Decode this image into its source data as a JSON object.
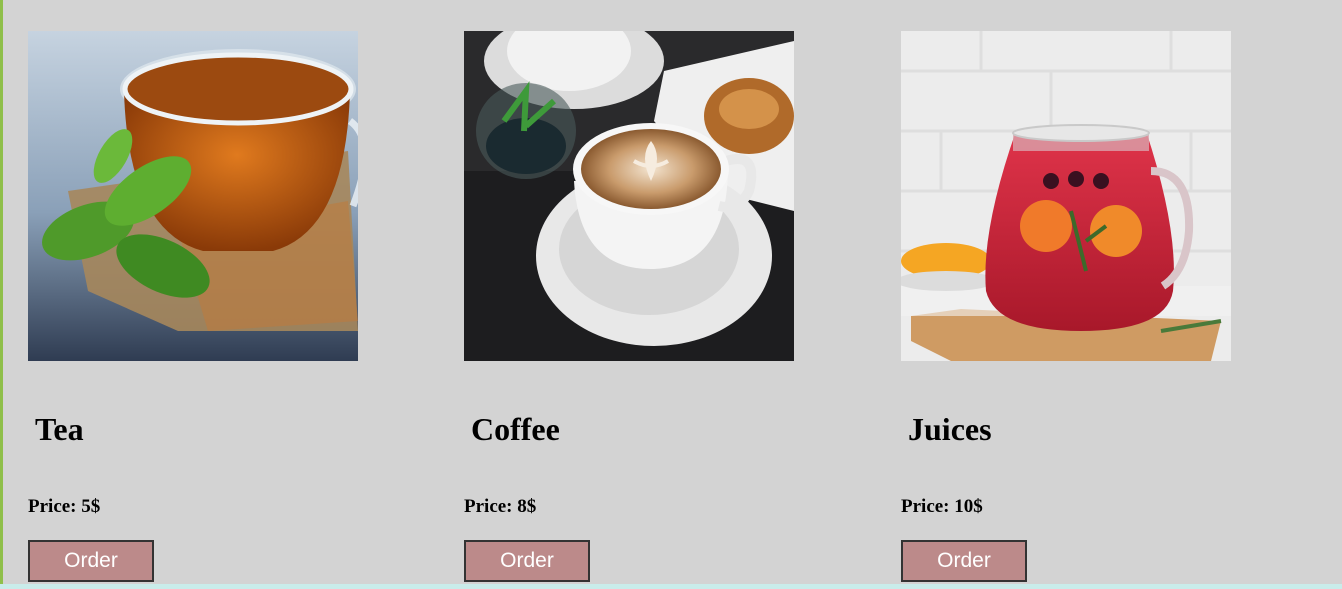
{
  "products": [
    {
      "name": "Tea",
      "price": "Price: 5$",
      "order_label": "Order",
      "image": "tea-cup-photo"
    },
    {
      "name": "Coffee",
      "price": "Price: 8$",
      "order_label": "Order",
      "image": "coffee-latte-photo"
    },
    {
      "name": "Juices",
      "price": "Price: 10$",
      "order_label": "Order",
      "image": "juice-pitcher-photo"
    }
  ],
  "colors": {
    "page_background": "#d3d3d3",
    "button_background": "#bc8a8a",
    "button_text": "#ffffff",
    "left_rule": "#8fbf4a",
    "bottom_strip": "#c9ecea"
  }
}
